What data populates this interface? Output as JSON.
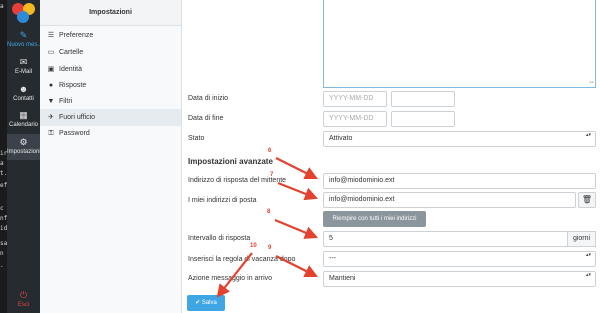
{
  "edge_fragments": [
    "a",
    "ir",
    "a",
    "t.",
    "ef",
    "c",
    "nf",
    "id",
    "sa",
    "n",
    "."
  ],
  "rail": {
    "items": [
      {
        "label": "Nuovo mes...",
        "icon": "compose-icon"
      },
      {
        "label": "E-Mail",
        "icon": "mail-icon"
      },
      {
        "label": "Contatti",
        "icon": "contacts-icon"
      },
      {
        "label": "Calendario",
        "icon": "calendar-icon"
      },
      {
        "label": "Impostazioni",
        "icon": "gear-icon"
      },
      {
        "label": "Esci",
        "icon": "power-icon"
      }
    ],
    "colors": {
      "accent": "#3fa6e6",
      "logout": "#e04a3f",
      "logo": [
        "#e83e3a",
        "#f5b921",
        "#2e8bd8"
      ]
    }
  },
  "sidebar": {
    "title": "Impostazioni",
    "items": [
      {
        "label": "Preferenze",
        "icon": "sliders-icon"
      },
      {
        "label": "Cartelle",
        "icon": "folder-icon"
      },
      {
        "label": "Identità",
        "icon": "id-card-icon"
      },
      {
        "label": "Risposte",
        "icon": "comment-icon"
      },
      {
        "label": "Filtri",
        "icon": "filter-icon"
      },
      {
        "label": "Fuori ufficio",
        "icon": "plane-icon"
      },
      {
        "label": "Password",
        "icon": "lock-icon"
      }
    ]
  },
  "form": {
    "start_date": {
      "label": "Data di inizio",
      "placeholder": "YYYY-MM-DD"
    },
    "end_date": {
      "label": "Data di fine",
      "placeholder": "YYYY-MM-DD"
    },
    "status": {
      "label": "Stato",
      "value": "Attivato"
    },
    "advanced_heading": "Impostazioni avanzate",
    "reply_address": {
      "label": "Indirizzo di risposta del mittente",
      "value": "info@miodominio.ext"
    },
    "my_addresses": {
      "label": "I miei indirizzi di posta",
      "value": "info@miodominio.ext"
    },
    "fill_all_button": "Riempire con tutti i miei indirizzi",
    "reply_interval": {
      "label": "Intervallo di risposta",
      "value": "5",
      "unit": "giorni"
    },
    "insert_rule": {
      "label": "Inserisci la regola di vacanza dopo",
      "value": "---"
    },
    "incoming_action": {
      "label": "Azione messaggio in arrivo",
      "value": "Mantieni"
    },
    "save_button": "Salva"
  },
  "annotations": [
    "6",
    "7",
    "8",
    "9",
    "10"
  ],
  "annotation_color": "#e2422e"
}
